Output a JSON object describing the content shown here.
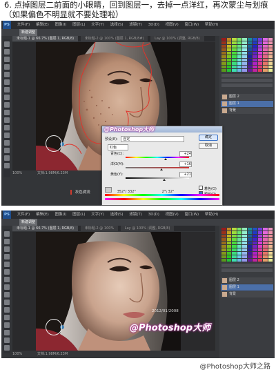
{
  "caption": {
    "line1": "6. 点掉图层二前面的小眼睛，回到图层一，去掉一点洋红，再次蒙尘与划痕",
    "line2": "（如果偏色不明显就不要处理啦）"
  },
  "ps_top": {
    "badge": "PS",
    "menu": [
      "文件(F)",
      "编辑(E)",
      "图像(I)",
      "图层(L)",
      "文字(Y)",
      "选择(S)",
      "滤镜(T)",
      "3D(D)",
      "视图(V)",
      "窗口(W)",
      "帮助(H)"
    ],
    "option_box": "新建调整",
    "tabs": [
      "未标题-1 @ 66.7% (图层 1, RGB/8)",
      "未标题-2 @ 100% (图层 1, RGB/8#)",
      "Lay @ 100% (调整, RGB/8)"
    ],
    "status": "文档:1.98M/6.23M",
    "footer_label": "灰色调流",
    "zoom": "100%"
  },
  "dialog": {
    "title_watermark": "@Photoshop大师",
    "preset_label": "预设(E):",
    "preset_value": "自定",
    "channel_value": "红色",
    "sliders": [
      {
        "label": "青色(C):",
        "value": "+24"
      },
      {
        "label": "洋红(M):",
        "value": "+16"
      },
      {
        "label": "黄色(Y):",
        "value": "+21"
      }
    ],
    "ok_label": "确定",
    "cancel_label": "取消",
    "colorize_label": "着色(O)",
    "preview_label": "预览(P)",
    "range_left": "352°/ 332°",
    "range_right": "2°\\ 32°"
  },
  "ps_bottom": {
    "badge": "PS",
    "menu": [
      "文件(F)",
      "编辑(E)",
      "图像(I)",
      "图层(L)",
      "文字(Y)",
      "选择(S)",
      "滤镜(T)",
      "3D(D)",
      "视图(V)",
      "窗口(W)",
      "帮助(H)"
    ],
    "option_box": "新建调整",
    "tabs": [
      "未标题-1 @ 66.7% (图层 1, RGB/8)",
      "未标题-2 @ 100%",
      "Lay @ 100% (调整, RGB/8)"
    ],
    "status": "文档:1.98M/6.23M",
    "zoom": "100%",
    "watermark": "@Photoshop大师",
    "date_watermark": "2012/01/2008"
  },
  "layers": {
    "rows": [
      "图层 2",
      "图层 1",
      "背景"
    ]
  },
  "footer_watermark": "@Photoshop大师之路"
}
